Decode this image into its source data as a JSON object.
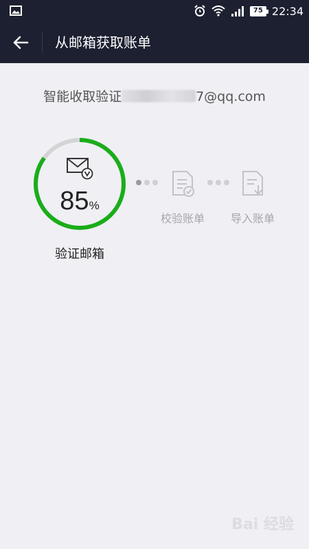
{
  "status_bar": {
    "left_icon": "gallery-icon",
    "icons": [
      "alarm-icon",
      "wifi-icon",
      "signal-icon"
    ],
    "battery": "75",
    "time": "22:34"
  },
  "app_bar": {
    "back_icon": "back-arrow-icon",
    "title": "从邮箱获取账单"
  },
  "email_line": {
    "prefix": "智能收取验证",
    "suffix": "7@qq.com"
  },
  "progress": {
    "value": "85",
    "unit": "%",
    "fraction": 0.85,
    "color": "#1aad19",
    "track_color": "#d4d4d6"
  },
  "steps": [
    {
      "label": "验证邮箱",
      "icon": "mail-verify-icon",
      "state": "active"
    },
    {
      "label": "校验账单",
      "icon": "document-check-icon",
      "state": "pending"
    },
    {
      "label": "导入账单",
      "icon": "document-import-icon",
      "state": "pending"
    }
  ],
  "watermark": "Bai 经验"
}
